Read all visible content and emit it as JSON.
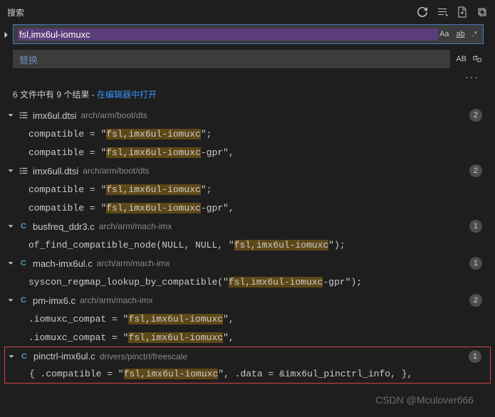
{
  "header": {
    "title": "搜索"
  },
  "search": {
    "query": "fsl,imx6ul-iomuxc",
    "case_label": "Aa",
    "word_label": "ab",
    "regex_label": ".*"
  },
  "replace": {
    "placeholder": "替换",
    "preserve_case_label": "AB"
  },
  "more": {
    "dots": "···"
  },
  "summary": {
    "text": "6 文件中有 9 个结果",
    "sep": " - ",
    "link": "在编辑器中打开"
  },
  "files": [
    {
      "kind": "dtsi",
      "name": "imx6ul.dtsi",
      "path": "arch/arm/boot/dts",
      "count": "2",
      "matches": [
        {
          "pre": "compatible = \"",
          "hl": "fsl,imx6ul-iomuxc",
          "post": "\";"
        },
        {
          "pre": "compatible = \"",
          "hl": "fsl,imx6ul-iomuxc",
          "post": "-gpr\","
        }
      ]
    },
    {
      "kind": "dtsi",
      "name": "imx6ull.dtsi",
      "path": "arch/arm/boot/dts",
      "count": "2",
      "matches": [
        {
          "pre": "compatible = \"",
          "hl": "fsl,imx6ul-iomuxc",
          "post": "\";"
        },
        {
          "pre": "compatible = \"",
          "hl": "fsl,imx6ul-iomuxc",
          "post": "-gpr\","
        }
      ]
    },
    {
      "kind": "c",
      "name": "busfreq_ddr3.c",
      "path": "arch/arm/mach-imx",
      "count": "1",
      "matches": [
        {
          "pre": "of_find_compatible_node(NULL, NULL, \"",
          "hl": "fsl,imx6ul-iomuxc",
          "post": "\");"
        }
      ]
    },
    {
      "kind": "c",
      "name": "mach-imx6ul.c",
      "path": "arch/arm/mach-imx",
      "count": "1",
      "matches": [
        {
          "pre": "syscon_regmap_lookup_by_compatible(\"",
          "hl": "fsl,imx6ul-iomuxc",
          "post": "-gpr\");"
        }
      ]
    },
    {
      "kind": "c",
      "name": "pm-imx6.c",
      "path": "arch/arm/mach-imx",
      "count": "2",
      "matches": [
        {
          "pre": ".iomuxc_compat = \"",
          "hl": "fsl,imx6ul-iomuxc",
          "post": "\","
        },
        {
          "pre": ".iomuxc_compat = \"",
          "hl": "fsl,imx6ul-iomuxc",
          "post": "\","
        }
      ]
    },
    {
      "kind": "c",
      "boxed": true,
      "name": "pinctrl-imx6ul.c",
      "path": "drivers/pinctrl/freescale",
      "count": "1",
      "matches": [
        {
          "pre": "{ .compatible = \"",
          "hl": "fsl,imx6ul-iomuxc",
          "post": "\", .data = &imx6ul_pinctrl_info, },"
        }
      ]
    }
  ],
  "watermark": "CSDN @Mculover666"
}
